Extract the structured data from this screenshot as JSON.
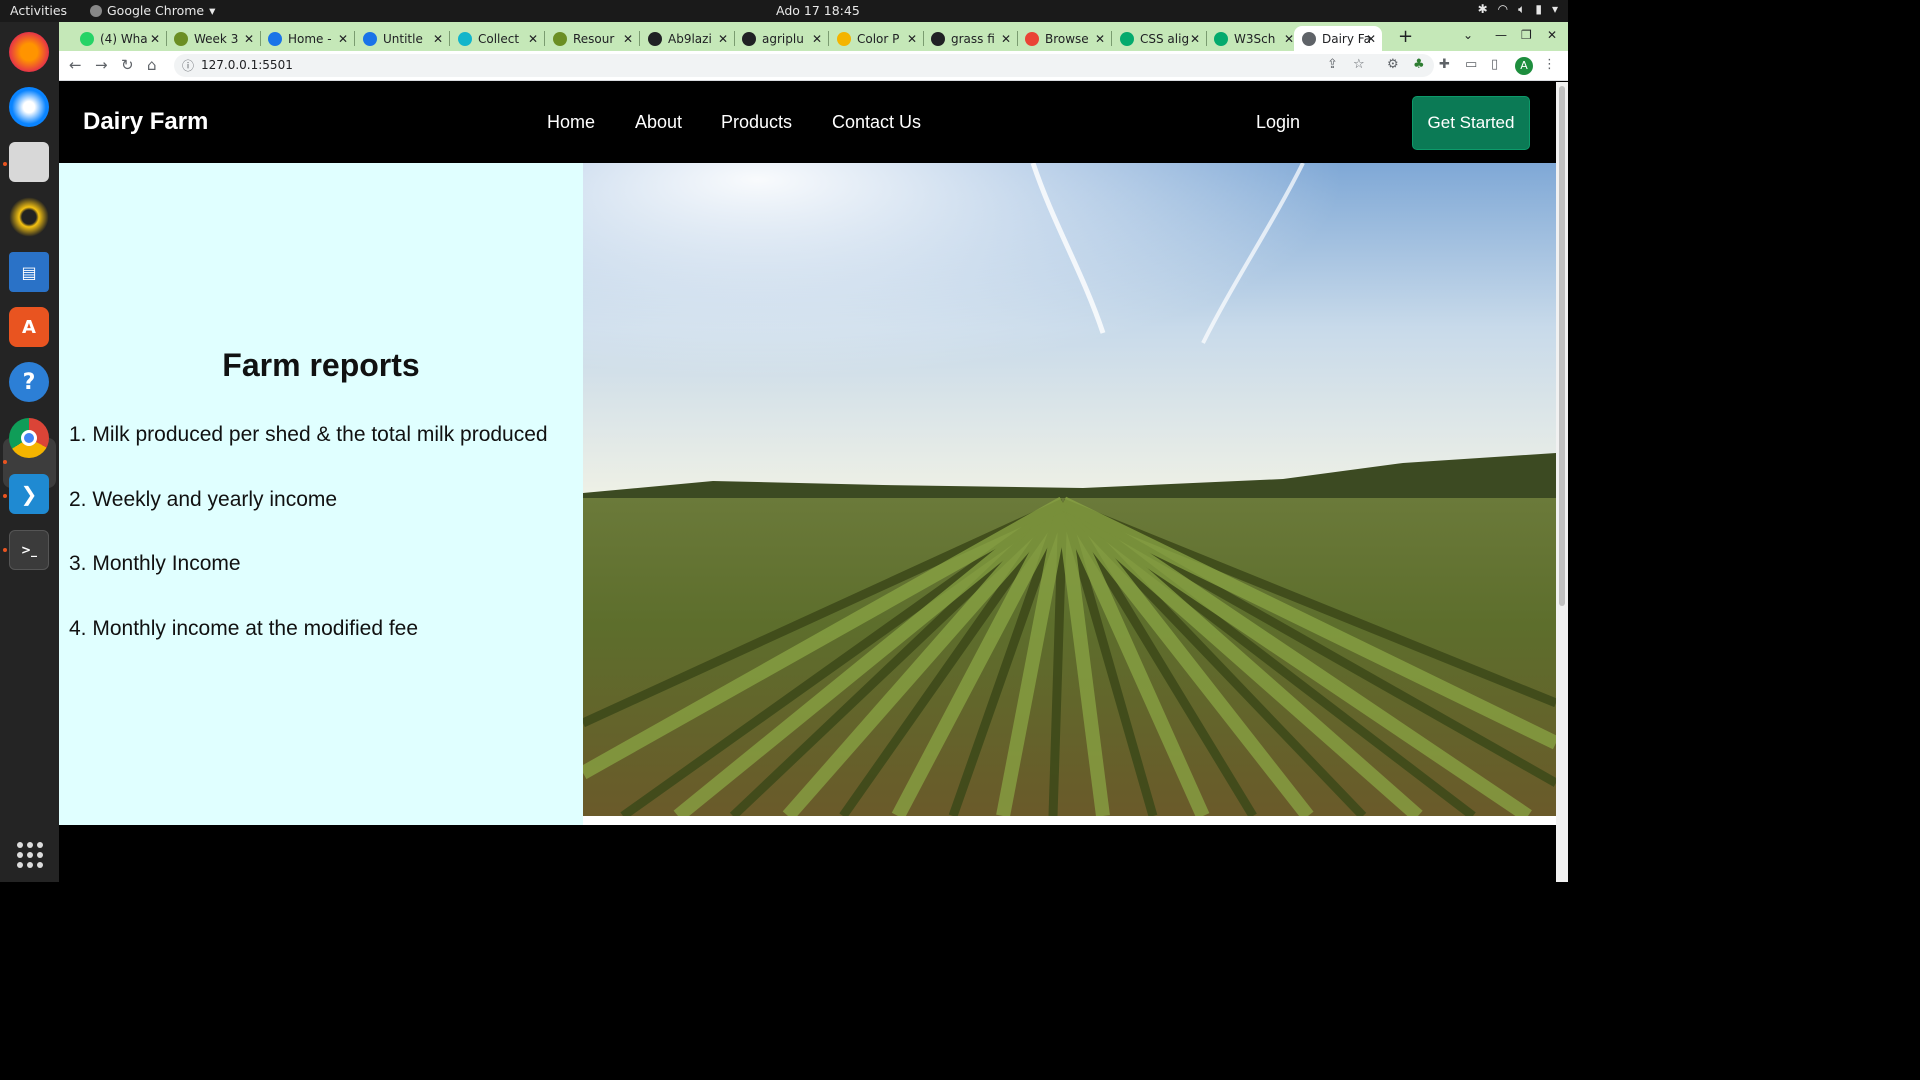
{
  "system": {
    "activities": "Activities",
    "app_name": "Google Chrome",
    "clock": "Ado 17  18:45"
  },
  "dock": {
    "apps": [
      "firefox-icon",
      "thunderbird-icon",
      "files-icon",
      "rhythmbox-icon",
      "writer-icon",
      "app-center-icon",
      "help-icon",
      "chrome-icon",
      "vscode-icon",
      "terminal-icon"
    ]
  },
  "browser": {
    "tabs": [
      {
        "label": "(4) Wha",
        "fav": "whatsapp-icon",
        "color": "#25d366"
      },
      {
        "label": "Week 3",
        "fav": "plant-icon",
        "color": "#6b8e23"
      },
      {
        "label": "Home -",
        "fav": "globe-icon",
        "color": "#1a73e8"
      },
      {
        "label": "Untitle",
        "fav": "globe-icon",
        "color": "#1a73e8"
      },
      {
        "label": "Collect",
        "fav": "figma-icon",
        "color": "#12b5cb"
      },
      {
        "label": "Resour",
        "fav": "plant-icon",
        "color": "#6b8e23"
      },
      {
        "label": "Ab9lazi",
        "fav": "github-icon",
        "color": "#202124"
      },
      {
        "label": "agriplu",
        "fav": "github-icon",
        "color": "#202124"
      },
      {
        "label": "Color P",
        "fav": "color-picker-icon",
        "color": "#f4b400"
      },
      {
        "label": "grass fi",
        "fav": "unsplash-icon",
        "color": "#202124"
      },
      {
        "label": "Browse",
        "fav": "grid-icon",
        "color": "#ea4335"
      },
      {
        "label": "CSS alig",
        "fav": "w3schools-icon",
        "color": "#04aa6d"
      },
      {
        "label": "W3Sch",
        "fav": "w3schools-icon",
        "color": "#04aa6d"
      },
      {
        "label": "Dairy Fa",
        "fav": "globe-icon",
        "color": "#5f6368"
      }
    ],
    "url": "127.0.0.1:5501"
  },
  "site": {
    "brand": "Dairy Farm",
    "nav": [
      "Home",
      "About",
      "Products",
      "Contact Us"
    ],
    "login": "Login",
    "cta": "Get Started",
    "reports": {
      "title": "Farm reports",
      "items": [
        "1. Milk produced per shed & the total milk produced",
        "2. Weekly and yearly income",
        "3. Monthly Income",
        "4. Monthly income at the modified fee"
      ]
    }
  },
  "colors": {
    "reports_bg": "#e0ffff",
    "cta_bg": "#0b7a55",
    "tabstrip_bg": "#c5e8b8"
  }
}
